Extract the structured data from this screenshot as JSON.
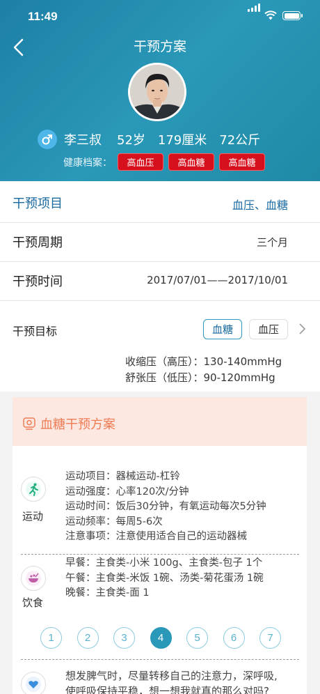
{
  "status": {
    "time": "11:49"
  },
  "nav": {
    "title": "干预方案"
  },
  "profile": {
    "name": "李三叔",
    "age": "52岁",
    "height": "179厘米",
    "weight": "72公斤",
    "health_label": "健康档案：",
    "tags": [
      "高血压",
      "高血糖",
      "高血糖"
    ]
  },
  "rows": {
    "project": {
      "label": "干预项目",
      "value": "血压、血糖"
    },
    "period": {
      "label": "干预周期",
      "value": "三个月"
    },
    "time": {
      "label": "干预时间",
      "value": "2017/07/01——2017/10/01"
    }
  },
  "goal": {
    "label": "干预目标",
    "chips": [
      "血糖",
      "血压"
    ],
    "lines": [
      "收缩压（高压）：130-140mmHg",
      "舒张压（低压）：90-120mmHg"
    ]
  },
  "plan": {
    "title": "血糖干预方案",
    "exercise": {
      "label": "运动",
      "lines": [
        "运动项目：器械运动-杠铃",
        "运动强度：心率120次/分钟",
        "运动时间：饭后30分钟，有氧运动每次5分钟",
        "运动频率：每周5-6次",
        "注意事项：注意使用适合自己的运动器械"
      ]
    },
    "diet": {
      "label": "饮食",
      "lines": [
        "早餐：主食类-小米 100g、主食类-包子 1个",
        "午餐：主食类-米饭 1碗、汤类-菊花蛋汤 1碗",
        "晚餐：主食类-面 1"
      ]
    },
    "pages": [
      "1",
      "2",
      "3",
      "4",
      "5",
      "6",
      "7"
    ],
    "active_page": "4",
    "mood": {
      "lines": [
        "想发脾气时，尽量转移自己的注意力，深呼吸,",
        "使呼吸保持平稳，想一想我就真的那么对吗?"
      ]
    }
  },
  "colors": {
    "accent": "#2a98b8",
    "tag_red": "#d7101e",
    "plan_orange": "#ef7c55"
  }
}
